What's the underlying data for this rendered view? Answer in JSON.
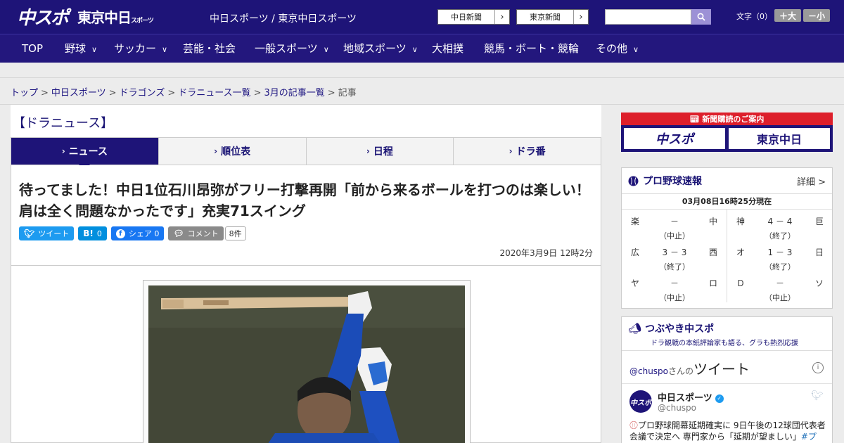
{
  "header": {
    "logo_main": "中スポ",
    "logo_tokyo": "東京中日",
    "logo_tokyo_small": "スポーツ",
    "site_title": "中日スポーツ / 東京中日スポーツ",
    "ext_links": [
      {
        "label": "中日新聞"
      },
      {
        "label": "東京新聞"
      }
    ],
    "search_placeholder": "",
    "font_label": "文字（0）",
    "font_up": "＋大",
    "font_down": "－小"
  },
  "nav": {
    "items": [
      {
        "label": "TOP",
        "dropdown": false
      },
      {
        "label": "野球",
        "dropdown": true
      },
      {
        "label": "サッカー",
        "dropdown": true
      },
      {
        "label": "芸能・社会",
        "dropdown": false
      },
      {
        "label": "一般スポーツ",
        "dropdown": true
      },
      {
        "label": "地域スポーツ",
        "dropdown": true
      },
      {
        "label": "大相撲",
        "dropdown": false
      },
      {
        "label": "競馬・ボート・競輪",
        "dropdown": false
      },
      {
        "label": "その他",
        "dropdown": true
      }
    ]
  },
  "breadcrumb": {
    "items": [
      "トップ",
      "中日スポーツ",
      "ドラゴンズ",
      "ドラニュース一覧",
      "3月の記事一覧"
    ],
    "current": "記事",
    "separator": ">"
  },
  "section": {
    "heading": "【ドラニュース】",
    "tabs": [
      {
        "label": "ニュース",
        "active": true
      },
      {
        "label": "順位表",
        "active": false
      },
      {
        "label": "日程",
        "active": false
      },
      {
        "label": "ドラ番",
        "active": false
      }
    ]
  },
  "article": {
    "headline": "待ってました！中日1位石川昂弥がフリー打撃再開「前から来るボールを打つのは楽しい！肩は全く問題なかったです」充実71スイング",
    "social": {
      "tweet_label": "ツイート",
      "hatena_label": "B!",
      "hatena_count": "0",
      "facebook_label": "シェア",
      "facebook_count": "0",
      "comment_label": "コメント",
      "comment_count": "8件"
    },
    "date": "2020年3月9日 12時2分"
  },
  "sidebar": {
    "subscribe": {
      "title": "新聞購読のご案内",
      "buttons": [
        "中スポ",
        "東京中日"
      ]
    },
    "scores": {
      "title": "プロ野球速報",
      "detail_link": "詳細 >",
      "as_of": "03月08日16時25分現在",
      "games": [
        {
          "home": "楽",
          "score": "－",
          "away": "中",
          "status": "（中止）"
        },
        {
          "home": "神",
          "score": "4 － 4",
          "away": "巨",
          "status": "（終了）"
        },
        {
          "home": "広",
          "score": "3 － 3",
          "away": "西",
          "status": "（終了）"
        },
        {
          "home": "オ",
          "score": "1 － 3",
          "away": "日",
          "status": "（終了）"
        },
        {
          "home": "ヤ",
          "score": "－",
          "away": "ロ",
          "status": "（中止）"
        },
        {
          "home": "Ｄ",
          "score": "－",
          "away": "ソ",
          "status": "（中止）"
        }
      ]
    },
    "tweets": {
      "title": "つぶやき中スポ",
      "subtitle": "ドラ観戦の本紙評論家も語る、グラも熱烈応援",
      "embed_handle_link": "@chuspo",
      "embed_san": "さんの",
      "embed_word": "ツイート",
      "info": "i",
      "account_name": "中日スポーツ",
      "account_handle": "@chuspo",
      "avatar_text": "中スポ",
      "tweet_text": "プロ野球開幕延期確実に 9日午後の12球団代表者会議で決定へ 専門家から「延期が望ましい」",
      "tweet_tag": "#プ"
    }
  },
  "colors": {
    "brand_navy": "#1e1478",
    "nav_navy": "#23177d",
    "accent_red": "#dd1f2b",
    "twitter_blue": "#1d9bf0",
    "hatena_blue": "#008fde",
    "facebook_blue": "#1877f2",
    "comment_gray": "#8a8a8a"
  }
}
